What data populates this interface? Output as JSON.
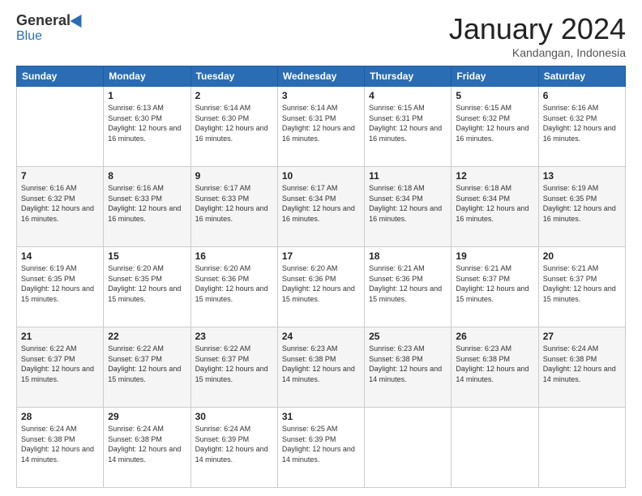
{
  "header": {
    "logo_general": "General",
    "logo_blue": "Blue",
    "title": "January 2024",
    "location": "Kandangan, Indonesia"
  },
  "columns": [
    "Sunday",
    "Monday",
    "Tuesday",
    "Wednesday",
    "Thursday",
    "Friday",
    "Saturday"
  ],
  "weeks": [
    [
      {
        "day": "",
        "sunrise": "",
        "sunset": "",
        "daylight": ""
      },
      {
        "day": "1",
        "sunrise": "Sunrise: 6:13 AM",
        "sunset": "Sunset: 6:30 PM",
        "daylight": "Daylight: 12 hours and 16 minutes."
      },
      {
        "day": "2",
        "sunrise": "Sunrise: 6:14 AM",
        "sunset": "Sunset: 6:30 PM",
        "daylight": "Daylight: 12 hours and 16 minutes."
      },
      {
        "day": "3",
        "sunrise": "Sunrise: 6:14 AM",
        "sunset": "Sunset: 6:31 PM",
        "daylight": "Daylight: 12 hours and 16 minutes."
      },
      {
        "day": "4",
        "sunrise": "Sunrise: 6:15 AM",
        "sunset": "Sunset: 6:31 PM",
        "daylight": "Daylight: 12 hours and 16 minutes."
      },
      {
        "day": "5",
        "sunrise": "Sunrise: 6:15 AM",
        "sunset": "Sunset: 6:32 PM",
        "daylight": "Daylight: 12 hours and 16 minutes."
      },
      {
        "day": "6",
        "sunrise": "Sunrise: 6:16 AM",
        "sunset": "Sunset: 6:32 PM",
        "daylight": "Daylight: 12 hours and 16 minutes."
      }
    ],
    [
      {
        "day": "7",
        "sunrise": "Sunrise: 6:16 AM",
        "sunset": "Sunset: 6:32 PM",
        "daylight": "Daylight: 12 hours and 16 minutes."
      },
      {
        "day": "8",
        "sunrise": "Sunrise: 6:16 AM",
        "sunset": "Sunset: 6:33 PM",
        "daylight": "Daylight: 12 hours and 16 minutes."
      },
      {
        "day": "9",
        "sunrise": "Sunrise: 6:17 AM",
        "sunset": "Sunset: 6:33 PM",
        "daylight": "Daylight: 12 hours and 16 minutes."
      },
      {
        "day": "10",
        "sunrise": "Sunrise: 6:17 AM",
        "sunset": "Sunset: 6:34 PM",
        "daylight": "Daylight: 12 hours and 16 minutes."
      },
      {
        "day": "11",
        "sunrise": "Sunrise: 6:18 AM",
        "sunset": "Sunset: 6:34 PM",
        "daylight": "Daylight: 12 hours and 16 minutes."
      },
      {
        "day": "12",
        "sunrise": "Sunrise: 6:18 AM",
        "sunset": "Sunset: 6:34 PM",
        "daylight": "Daylight: 12 hours and 16 minutes."
      },
      {
        "day": "13",
        "sunrise": "Sunrise: 6:19 AM",
        "sunset": "Sunset: 6:35 PM",
        "daylight": "Daylight: 12 hours and 16 minutes."
      }
    ],
    [
      {
        "day": "14",
        "sunrise": "Sunrise: 6:19 AM",
        "sunset": "Sunset: 6:35 PM",
        "daylight": "Daylight: 12 hours and 15 minutes."
      },
      {
        "day": "15",
        "sunrise": "Sunrise: 6:20 AM",
        "sunset": "Sunset: 6:35 PM",
        "daylight": "Daylight: 12 hours and 15 minutes."
      },
      {
        "day": "16",
        "sunrise": "Sunrise: 6:20 AM",
        "sunset": "Sunset: 6:36 PM",
        "daylight": "Daylight: 12 hours and 15 minutes."
      },
      {
        "day": "17",
        "sunrise": "Sunrise: 6:20 AM",
        "sunset": "Sunset: 6:36 PM",
        "daylight": "Daylight: 12 hours and 15 minutes."
      },
      {
        "day": "18",
        "sunrise": "Sunrise: 6:21 AM",
        "sunset": "Sunset: 6:36 PM",
        "daylight": "Daylight: 12 hours and 15 minutes."
      },
      {
        "day": "19",
        "sunrise": "Sunrise: 6:21 AM",
        "sunset": "Sunset: 6:37 PM",
        "daylight": "Daylight: 12 hours and 15 minutes."
      },
      {
        "day": "20",
        "sunrise": "Sunrise: 6:21 AM",
        "sunset": "Sunset: 6:37 PM",
        "daylight": "Daylight: 12 hours and 15 minutes."
      }
    ],
    [
      {
        "day": "21",
        "sunrise": "Sunrise: 6:22 AM",
        "sunset": "Sunset: 6:37 PM",
        "daylight": "Daylight: 12 hours and 15 minutes."
      },
      {
        "day": "22",
        "sunrise": "Sunrise: 6:22 AM",
        "sunset": "Sunset: 6:37 PM",
        "daylight": "Daylight: 12 hours and 15 minutes."
      },
      {
        "day": "23",
        "sunrise": "Sunrise: 6:22 AM",
        "sunset": "Sunset: 6:37 PM",
        "daylight": "Daylight: 12 hours and 15 minutes."
      },
      {
        "day": "24",
        "sunrise": "Sunrise: 6:23 AM",
        "sunset": "Sunset: 6:38 PM",
        "daylight": "Daylight: 12 hours and 14 minutes."
      },
      {
        "day": "25",
        "sunrise": "Sunrise: 6:23 AM",
        "sunset": "Sunset: 6:38 PM",
        "daylight": "Daylight: 12 hours and 14 minutes."
      },
      {
        "day": "26",
        "sunrise": "Sunrise: 6:23 AM",
        "sunset": "Sunset: 6:38 PM",
        "daylight": "Daylight: 12 hours and 14 minutes."
      },
      {
        "day": "27",
        "sunrise": "Sunrise: 6:24 AM",
        "sunset": "Sunset: 6:38 PM",
        "daylight": "Daylight: 12 hours and 14 minutes."
      }
    ],
    [
      {
        "day": "28",
        "sunrise": "Sunrise: 6:24 AM",
        "sunset": "Sunset: 6:38 PM",
        "daylight": "Daylight: 12 hours and 14 minutes."
      },
      {
        "day": "29",
        "sunrise": "Sunrise: 6:24 AM",
        "sunset": "Sunset: 6:38 PM",
        "daylight": "Daylight: 12 hours and 14 minutes."
      },
      {
        "day": "30",
        "sunrise": "Sunrise: 6:24 AM",
        "sunset": "Sunset: 6:39 PM",
        "daylight": "Daylight: 12 hours and 14 minutes."
      },
      {
        "day": "31",
        "sunrise": "Sunrise: 6:25 AM",
        "sunset": "Sunset: 6:39 PM",
        "daylight": "Daylight: 12 hours and 14 minutes."
      },
      {
        "day": "",
        "sunrise": "",
        "sunset": "",
        "daylight": ""
      },
      {
        "day": "",
        "sunrise": "",
        "sunset": "",
        "daylight": ""
      },
      {
        "day": "",
        "sunrise": "",
        "sunset": "",
        "daylight": ""
      }
    ]
  ]
}
